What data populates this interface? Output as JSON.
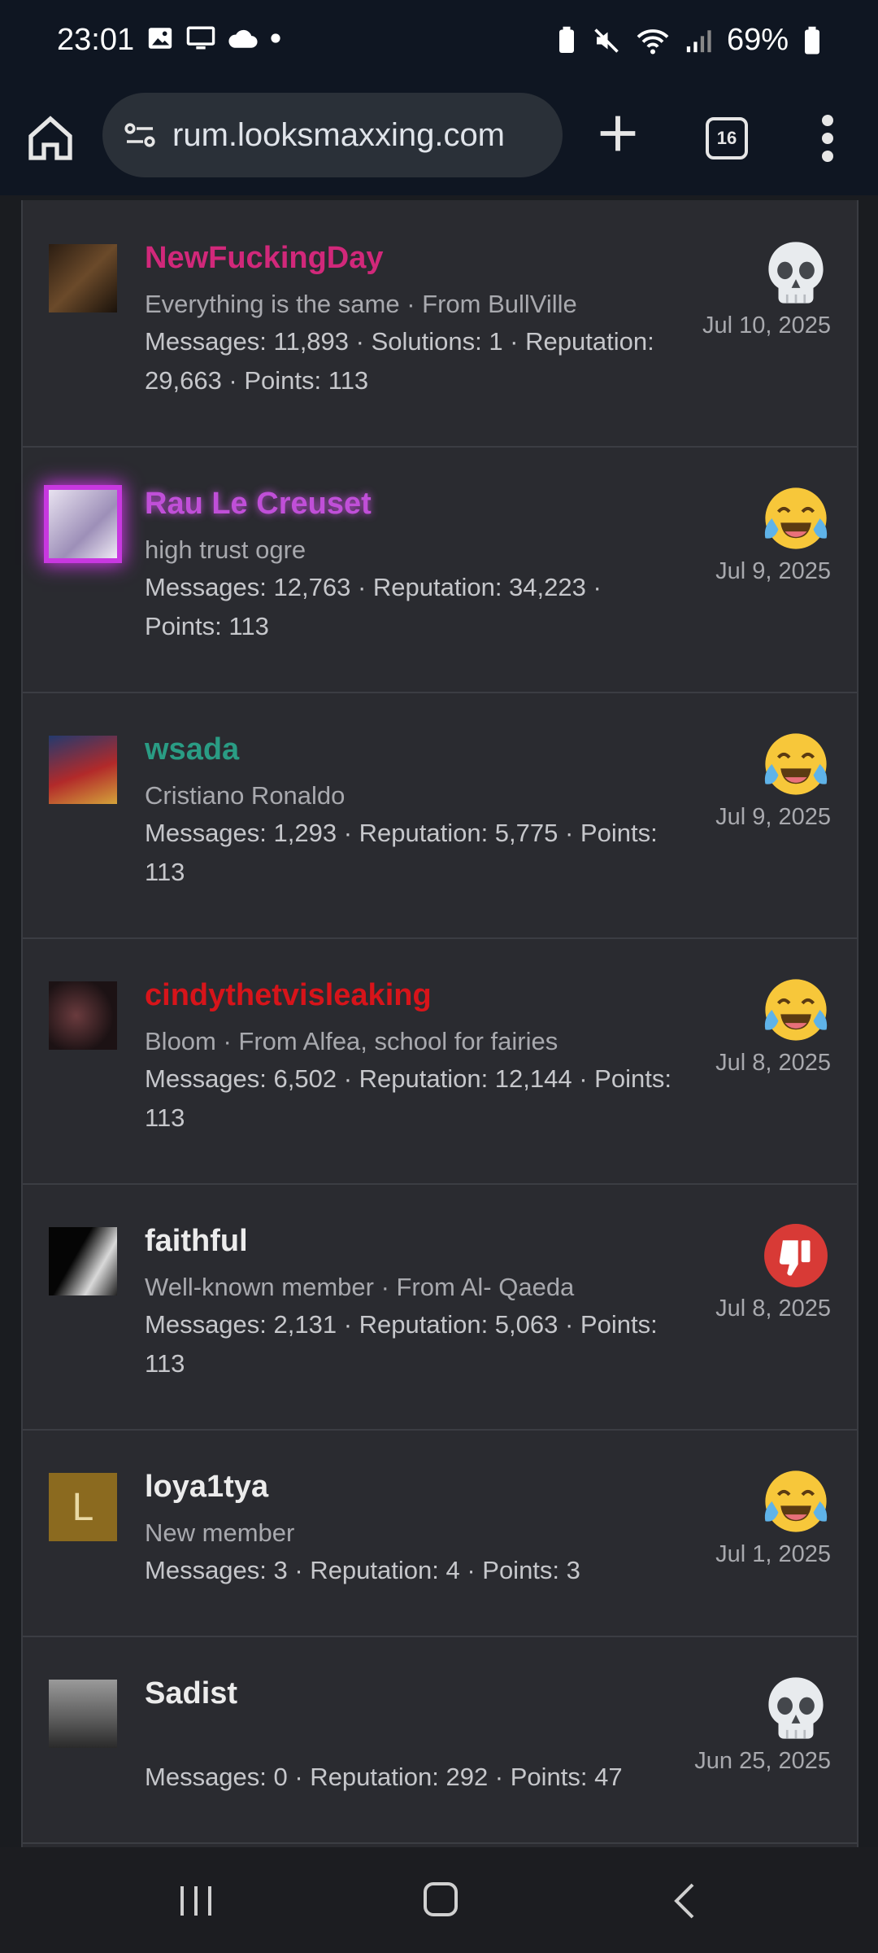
{
  "status": {
    "time": "23:01",
    "battery": "69%"
  },
  "browser": {
    "url": "rum.looksmaxxing.com",
    "tab_count": "16"
  },
  "members": [
    {
      "name": "NewFuckingDay",
      "name_color": "#d1287a",
      "title": "Everything is the same · From BullVille",
      "stats": "Messages: 11,893 · Solutions: 1 · Reputation: 29,663 · Points: 113",
      "reaction": "skull-icon",
      "date": "Jul 10, 2025"
    },
    {
      "name": "Rau Le Creuset",
      "name_color": "#c04fd8",
      "title": "high trust ogre",
      "stats": "Messages: 12,763 · Reputation: 34,223 · Points: 113",
      "reaction": "laughing-crying-icon",
      "date": "Jul 9, 2025"
    },
    {
      "name": "wsada",
      "name_color": "#2a9c84",
      "title": "Cristiano Ronaldo",
      "stats": "Messages: 1,293 · Reputation: 5,775 · Points: 113",
      "reaction": "laughing-crying-icon",
      "date": "Jul 9, 2025"
    },
    {
      "name": "cindythetvisleaking",
      "name_color": "#d7141a",
      "title": "Bloom · From Alfea, school for fairies",
      "stats": "Messages: 6,502 · Reputation: 12,144 · Points: 113",
      "reaction": "laughing-crying-icon",
      "date": "Jul 8, 2025"
    },
    {
      "name": "faithful",
      "name_color": "#ececec",
      "title": "Well-known member · From Al- Qaeda",
      "stats": "Messages: 2,131 · Reputation: 5,063 · Points: 113",
      "reaction": "thumbs-down-icon",
      "date": "Jul 8, 2025"
    },
    {
      "name": "loya1tya",
      "name_color": "#ececec",
      "avatar_letter": "L",
      "title": "New member",
      "stats": "Messages: 3 · Reputation: 4 · Points: 3",
      "reaction": "laughing-crying-icon",
      "date": "Jul 1, 2025"
    },
    {
      "name": "Sadist",
      "name_color": "#ececec",
      "title": "",
      "stats": "Messages: 0 · Reputation: 292 · Points: 47",
      "reaction": "skull-icon",
      "date": "Jun 25, 2025"
    }
  ]
}
